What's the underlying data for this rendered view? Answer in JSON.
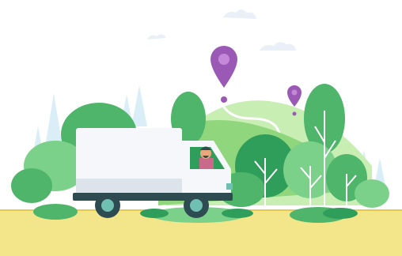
{
  "illustration": {
    "subject": "delivery-truck-driving-through-green-hills-with-map-pins",
    "colors": {
      "background": "#ffffff",
      "hill_light": "#c8eeb4",
      "hill_mid": "#8fd67d",
      "hill_dark": "#4fb56a",
      "tree_dark": "#2f9e5a",
      "tree_light": "#7bd08a",
      "pine_pale": "#d9eef6",
      "cloud": "#e9f0f8",
      "truck_body": "#f5f7fa",
      "truck_shadow": "#dde3ea",
      "truck_chassis": "#2f4b52",
      "wheel_teal": "#6fbfb3",
      "pin_purple": "#9b59b6",
      "pin_purple_light": "#c689d9",
      "road_yellow": "#f3e58a",
      "road_line": "#e5c94a",
      "driver_skin": "#e8a77d",
      "driver_shirt": "#c96a8a"
    },
    "icons": [
      "map-pin-icon",
      "map-pin-icon",
      "delivery-truck-icon",
      "driver-figure",
      "cloud-icon",
      "tree-icon"
    ]
  }
}
